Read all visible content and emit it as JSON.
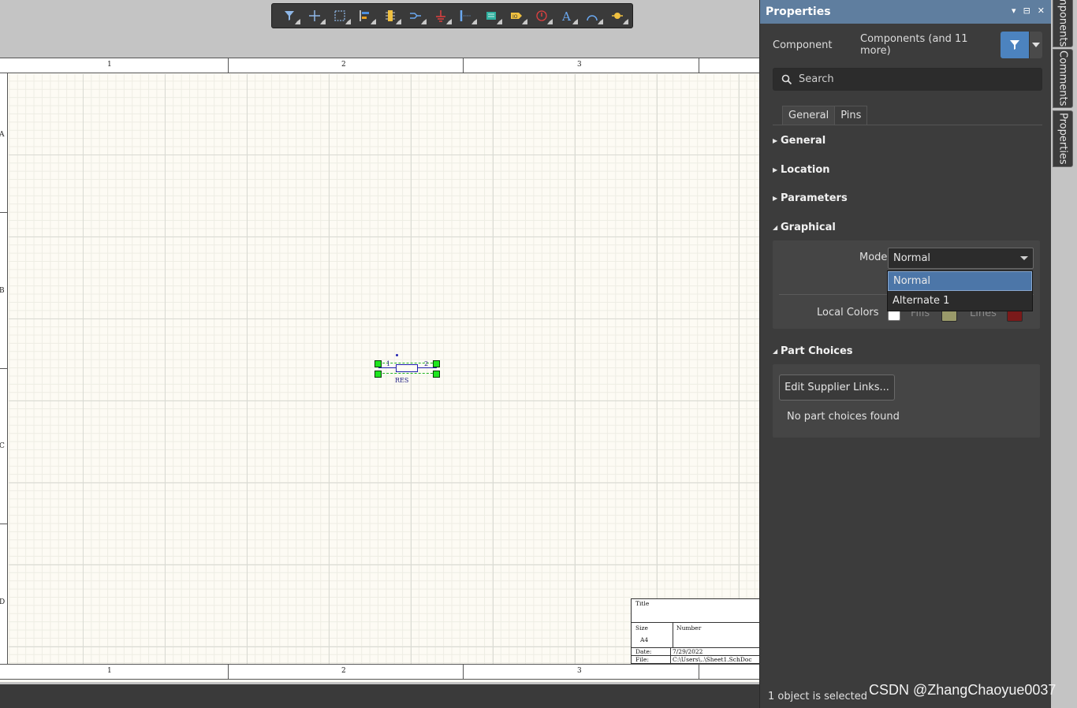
{
  "toolbar": {
    "tools": [
      {
        "icon": "filter-icon"
      },
      {
        "icon": "crosshair-plus-icon"
      },
      {
        "icon": "select-rectangle-icon"
      },
      {
        "icon": "align-left-icon"
      },
      {
        "icon": "part-icon"
      },
      {
        "icon": "wire-icon"
      },
      {
        "icon": "ground-icon"
      },
      {
        "icon": "bus-icon"
      },
      {
        "icon": "harness-icon"
      },
      {
        "icon": "net-label-icon"
      },
      {
        "icon": "directive-icon"
      },
      {
        "icon": "text-icon"
      },
      {
        "icon": "arc-icon"
      },
      {
        "icon": "port-icon"
      }
    ]
  },
  "sheet": {
    "zones_x": [
      "1",
      "2",
      "3"
    ],
    "zones_y": [
      "A",
      "B",
      "C",
      "D"
    ],
    "component": {
      "designator_pins": [
        "1",
        "2"
      ],
      "comment": "RES"
    },
    "title_block": {
      "title_label": "Title",
      "size_label": "Size",
      "size_value": "A4",
      "number_label": "Number",
      "date_label": "Date:",
      "date_value": "7/29/2022",
      "file_label": "File:",
      "file_value": "C:\\Users\\..\\Sheet1.SchDoc"
    }
  },
  "panel": {
    "title": "Properties",
    "kind_label": "Component",
    "selection_desc": "Components (and 11 more)",
    "search_placeholder": "Search",
    "tabs": [
      {
        "label": "General"
      },
      {
        "label": "Pins"
      }
    ],
    "sections": {
      "general": "General",
      "location": "Location",
      "parameters": "Parameters",
      "graphical": "Graphical",
      "part_choices": "Part Choices"
    },
    "graphical": {
      "mode_label": "Mode",
      "mode_value": "Normal",
      "mode_options": [
        "Normal",
        "Alternate 1"
      ],
      "local_colors_label": "Local Colors",
      "fills_label": "Fills",
      "lines_label": "Lines",
      "fills_color": "#9a9a6a",
      "lines_color": "#7a1a1a"
    },
    "part_choices": {
      "edit_button": "Edit Supplier Links...",
      "empty_text": "No part choices found"
    },
    "status": "1 object is selected"
  },
  "side_tabs": [
    "Components",
    "Comments",
    "Properties"
  ],
  "watermark": "CSDN @ZhangChaoyue0037",
  "colors": {
    "panel_header": "#5f7e9f",
    "accent": "#4c83bf",
    "selection_handle": "#1ee61e"
  }
}
